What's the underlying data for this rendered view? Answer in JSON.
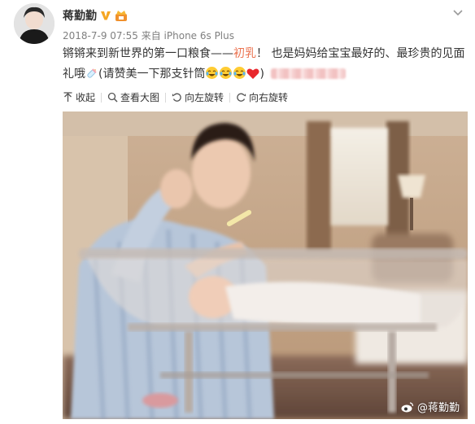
{
  "author": {
    "name": "蒋勤勤",
    "verified_icon": "verified-v-icon",
    "member_icon": "vip-crown-icon"
  },
  "post": {
    "timestamp": "2018-7-9 07:55",
    "source_prefix": "来自",
    "source": "iPhone 6s Plus",
    "text": {
      "part1": "锵锵来到新世界的第一口粮食——",
      "highlight": "初乳",
      "part2": "！ 也是妈妈给宝宝最好的、最珍贵的见面礼哦",
      "part3": "(请赞美一下那支针筒",
      "part4": ")"
    }
  },
  "toolbar": {
    "collapse": "收起",
    "view_large": "查看大图",
    "rotate_left": "向左旋转",
    "rotate_right": "向右旋转"
  },
  "photo": {
    "watermark": "@蒋勤勤"
  },
  "colors": {
    "highlight": "#eb7350",
    "text": "#333333",
    "meta": "#808080"
  }
}
